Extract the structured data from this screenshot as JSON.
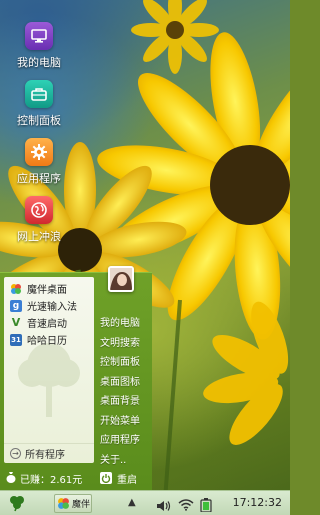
{
  "desktop": {
    "icons": [
      {
        "label": "我的电脑",
        "icon": "monitor-icon",
        "color": "#7a3fc8"
      },
      {
        "label": "控制面板",
        "icon": "toolbox-icon",
        "color": "#1cb89e"
      },
      {
        "label": "应用程序",
        "icon": "gear-icon",
        "color": "#f58a20"
      },
      {
        "label": "网上冲浪",
        "icon": "globe-icon",
        "color": "#e03a3a"
      }
    ]
  },
  "start_menu": {
    "left_items": [
      {
        "label": "魔伴桌面",
        "icon": "pinwheel-icon"
      },
      {
        "label": "光速输入法",
        "icon": "input-method-icon",
        "glyph": "g"
      },
      {
        "label": "音速启动",
        "icon": "checkmark-v-icon",
        "glyph": "V"
      },
      {
        "label": "哈哈日历",
        "icon": "calendar-icon",
        "glyph": "31"
      }
    ],
    "all_programs_label": "所有程序",
    "right_items": [
      "我的电脑",
      "文明搜索",
      "控制面板",
      "桌面图标",
      "桌面背景",
      "开始菜单",
      "应用程序",
      "关于.."
    ],
    "earned_label": "已赚：2.61元",
    "restart_label": "重启"
  },
  "taskbar": {
    "start_icon": "clover-icon",
    "app_label": "魔伴",
    "clock": "17:12:32",
    "tray_icons": [
      "tray-up-arrow-icon",
      "volume-icon",
      "wifi-icon",
      "battery-icon"
    ]
  },
  "colors": {
    "menu_green": "#5f9020",
    "taskbar_bg": "#cfe2c4"
  }
}
